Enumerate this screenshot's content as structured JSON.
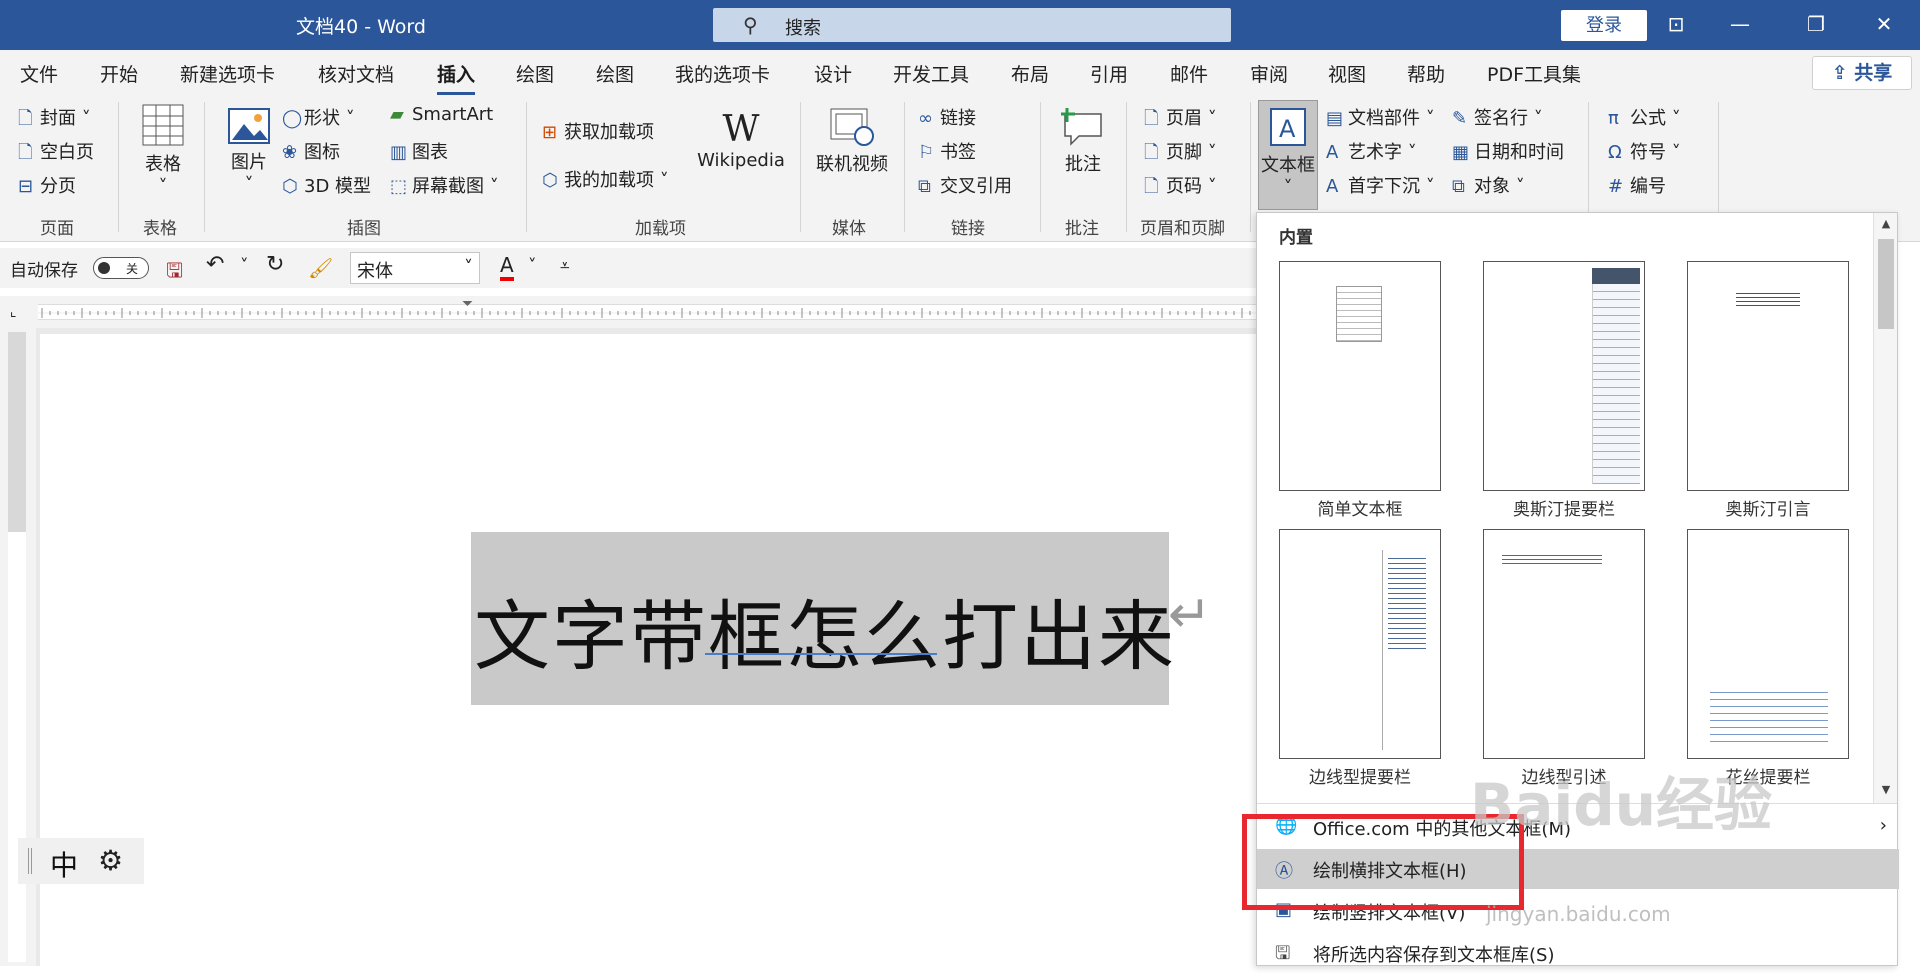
{
  "titlebar": {
    "doc_title": "文档40  -  Word",
    "search_placeholder": "搜索",
    "login": "登录"
  },
  "tabs": [
    "文件",
    "开始",
    "新建选项卡",
    "核对文档",
    "插入",
    "绘图",
    "绘图",
    "我的选项卡",
    "设计",
    "开发工具",
    "布局",
    "引用",
    "邮件",
    "审阅",
    "视图",
    "帮助",
    "PDF工具集"
  ],
  "share": "共享",
  "ribbon": {
    "pages": {
      "cover": "封面",
      "blank": "空白页",
      "break": "分页",
      "group": "页面"
    },
    "table": {
      "label": "表格",
      "group": "表格"
    },
    "illustrations": {
      "picture": "图片",
      "shapes": "形状",
      "icons": "图标",
      "model3d": "3D 模型",
      "smartart": "SmartArt",
      "chart": "图表",
      "screenshot": "屏幕截图",
      "group": "插图"
    },
    "addins": {
      "get": "获取加载项",
      "mine": "我的加载项",
      "wikipedia": "Wikipedia",
      "group": "加载项"
    },
    "media": {
      "video": "联机视频",
      "group": "媒体"
    },
    "links": {
      "link": "链接",
      "bookmark": "书签",
      "crossref": "交叉引用",
      "group": "链接"
    },
    "comments": {
      "comment": "批注",
      "group": "批注"
    },
    "headerfooter": {
      "header": "页眉",
      "footer": "页脚",
      "pagenum": "页码",
      "group": "页眉和页脚"
    },
    "text": {
      "textbox": "文本框",
      "quickparts": "文档部件",
      "wordart": "艺术字",
      "dropcap": "首字下沉",
      "signature": "签名行",
      "datetime": "日期和时间",
      "object": "对象"
    },
    "symbols": {
      "equation": "公式",
      "symbol": "符号",
      "number": "编号"
    }
  },
  "qat": {
    "autosave": "自动保存",
    "toggle": "关",
    "font": "宋体"
  },
  "document": {
    "text": "文字带框怎么打出来"
  },
  "ime": {
    "mode": "中"
  },
  "dropdown": {
    "section": "内置",
    "thumbs": [
      "简单文本框",
      "奥斯汀提要栏",
      "奥斯汀引言",
      "边线型提要栏",
      "边线型引述",
      "花丝提要栏"
    ],
    "items": [
      "Office.com 中的其他文本框(M)",
      "绘制横排文本框(H)",
      "绘制竖排文本框(V)",
      "将所选内容保存到文本框库(S)"
    ]
  },
  "watermark": {
    "brand": "Baidu经验",
    "url": "jingyan.baidu.com"
  },
  "colors": {
    "accent": "#2b579a",
    "highlight": "#e8282e"
  }
}
